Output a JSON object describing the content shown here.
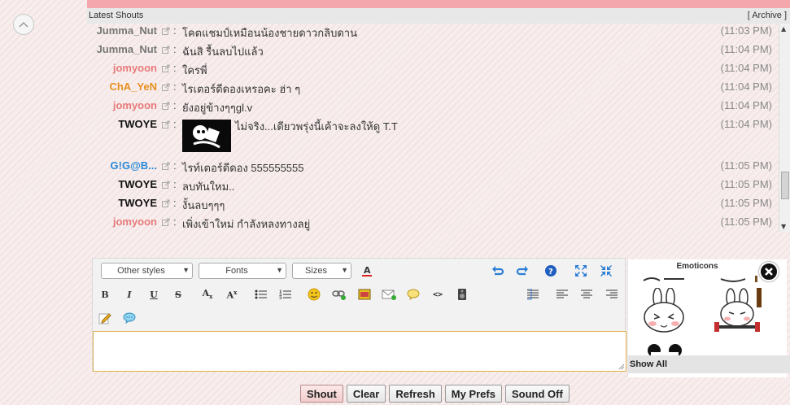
{
  "header": {
    "title": "Latest Shouts",
    "archive_label": "[ Archive ]"
  },
  "shouts": [
    {
      "name": "Jumma_Nut",
      "name_color": "#777777",
      "message": "โคตแชมป์เหมือนน้องชายดาวกลิบดาน",
      "time": "(11:03 PM)"
    },
    {
      "name": "Jumma_Nut",
      "name_color": "#777777",
      "message": "ฉันสิ รื้นลบไปแล้ว",
      "time": "(11:04 PM)"
    },
    {
      "name": "jomyoon",
      "name_color": "#e87a7a",
      "message": "ใครพี่",
      "time": "(11:04 PM)"
    },
    {
      "name": "ChA_YeN",
      "name_color": "#e89020",
      "message": "ไรเตอร์ดีดองเหรอคะ ฮ่า ๆ",
      "time": "(11:04 PM)"
    },
    {
      "name": "jomyoon",
      "name_color": "#e87a7a",
      "message": "ยังอยู่ข้างๆๆgl.v",
      "time": "(11:04 PM)"
    },
    {
      "name": "TWOYE",
      "name_color": "#111111",
      "message": "ไม่จริง...เดียวพรุ่งนี้เค้าจะลงให้ดู T.T",
      "time": "(11:04 PM)"
    },
    {
      "name": "G!G@B...",
      "name_color": "#2a8ad8",
      "message": "ไรท์เตอร์ดีดอง 555555555",
      "time": "(11:05 PM)"
    },
    {
      "name": "TWOYE",
      "name_color": "#111111",
      "message": "ลบทันใหม..",
      "time": "(11:05 PM)"
    },
    {
      "name": "TWOYE",
      "name_color": "#111111",
      "message": "งั้นลบๆๆๆ",
      "time": "(11:05 PM)"
    },
    {
      "name": "jomyoon",
      "name_color": "#e87a7a",
      "message": "เพิ่งเข้าใหม่ กำลังหลงทางลยู่",
      "time": "(11:05 PM)"
    }
  ],
  "editor": {
    "styles_label": "Other styles",
    "fonts_label": "Fonts",
    "sizes_label": "Sizes",
    "text_value": ""
  },
  "emoticons": {
    "title": "Emoticons",
    "show_all": "Show All"
  },
  "buttons": {
    "shout": "Shout",
    "clear": "Clear",
    "refresh": "Refresh",
    "prefs": "My Prefs",
    "sound": "Sound Off"
  }
}
